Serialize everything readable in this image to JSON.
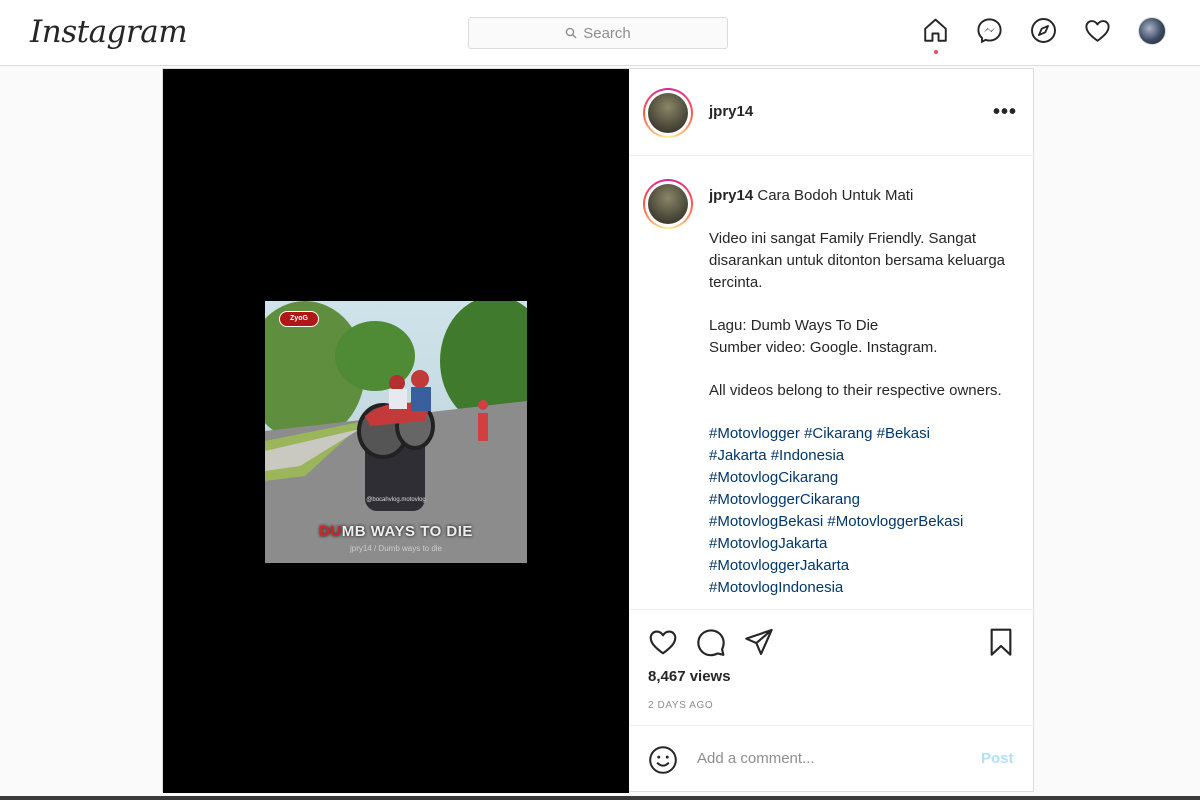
{
  "nav": {
    "logo": "Instagram",
    "search_placeholder": "Search",
    "icons": [
      "home-icon",
      "messenger-icon",
      "explore-icon",
      "activity-heart-icon",
      "profile-avatar"
    ]
  },
  "post": {
    "username": "jpry14",
    "more_label": "•••",
    "video": {
      "badge": "ZyoG",
      "title_red": "DU",
      "title_rest": "MB WAYS TO DIE",
      "subtitle": "jpry14 / Dumb ways to die",
      "watermark": "@bocahvlog.motovlog"
    },
    "caption": {
      "username": "jpry14",
      "title": "Cara Bodoh Untuk Mati",
      "paragraphs": [
        "Video ini sangat Family Friendly. Sangat disarankan untuk ditonton bersama keluarga tercinta.",
        "Lagu: Dumb Ways To Die\nSumber video: Google. Instagram.",
        "All videos belong to their respective owners."
      ],
      "hashtags": [
        "#Motovlogger",
        "#Cikarang",
        "#Bekasi",
        "#Jakarta",
        "#Indonesia",
        "#MotovlogCikarang",
        "#MotovloggerCikarang",
        "#MotovlogBekasi",
        "#MotovloggerBekasi",
        "#MotovlogJakarta",
        "#MotovloggerJakarta",
        "#MotovlogIndonesia"
      ]
    },
    "views": "8,467 views",
    "time": "2 DAYS AGO",
    "comment_placeholder": "Add a comment...",
    "post_button": "Post"
  },
  "colors": {
    "hashtag": "#00376b",
    "notification_dot": "#ed4956",
    "post_button_disabled": "#b2dffc"
  }
}
